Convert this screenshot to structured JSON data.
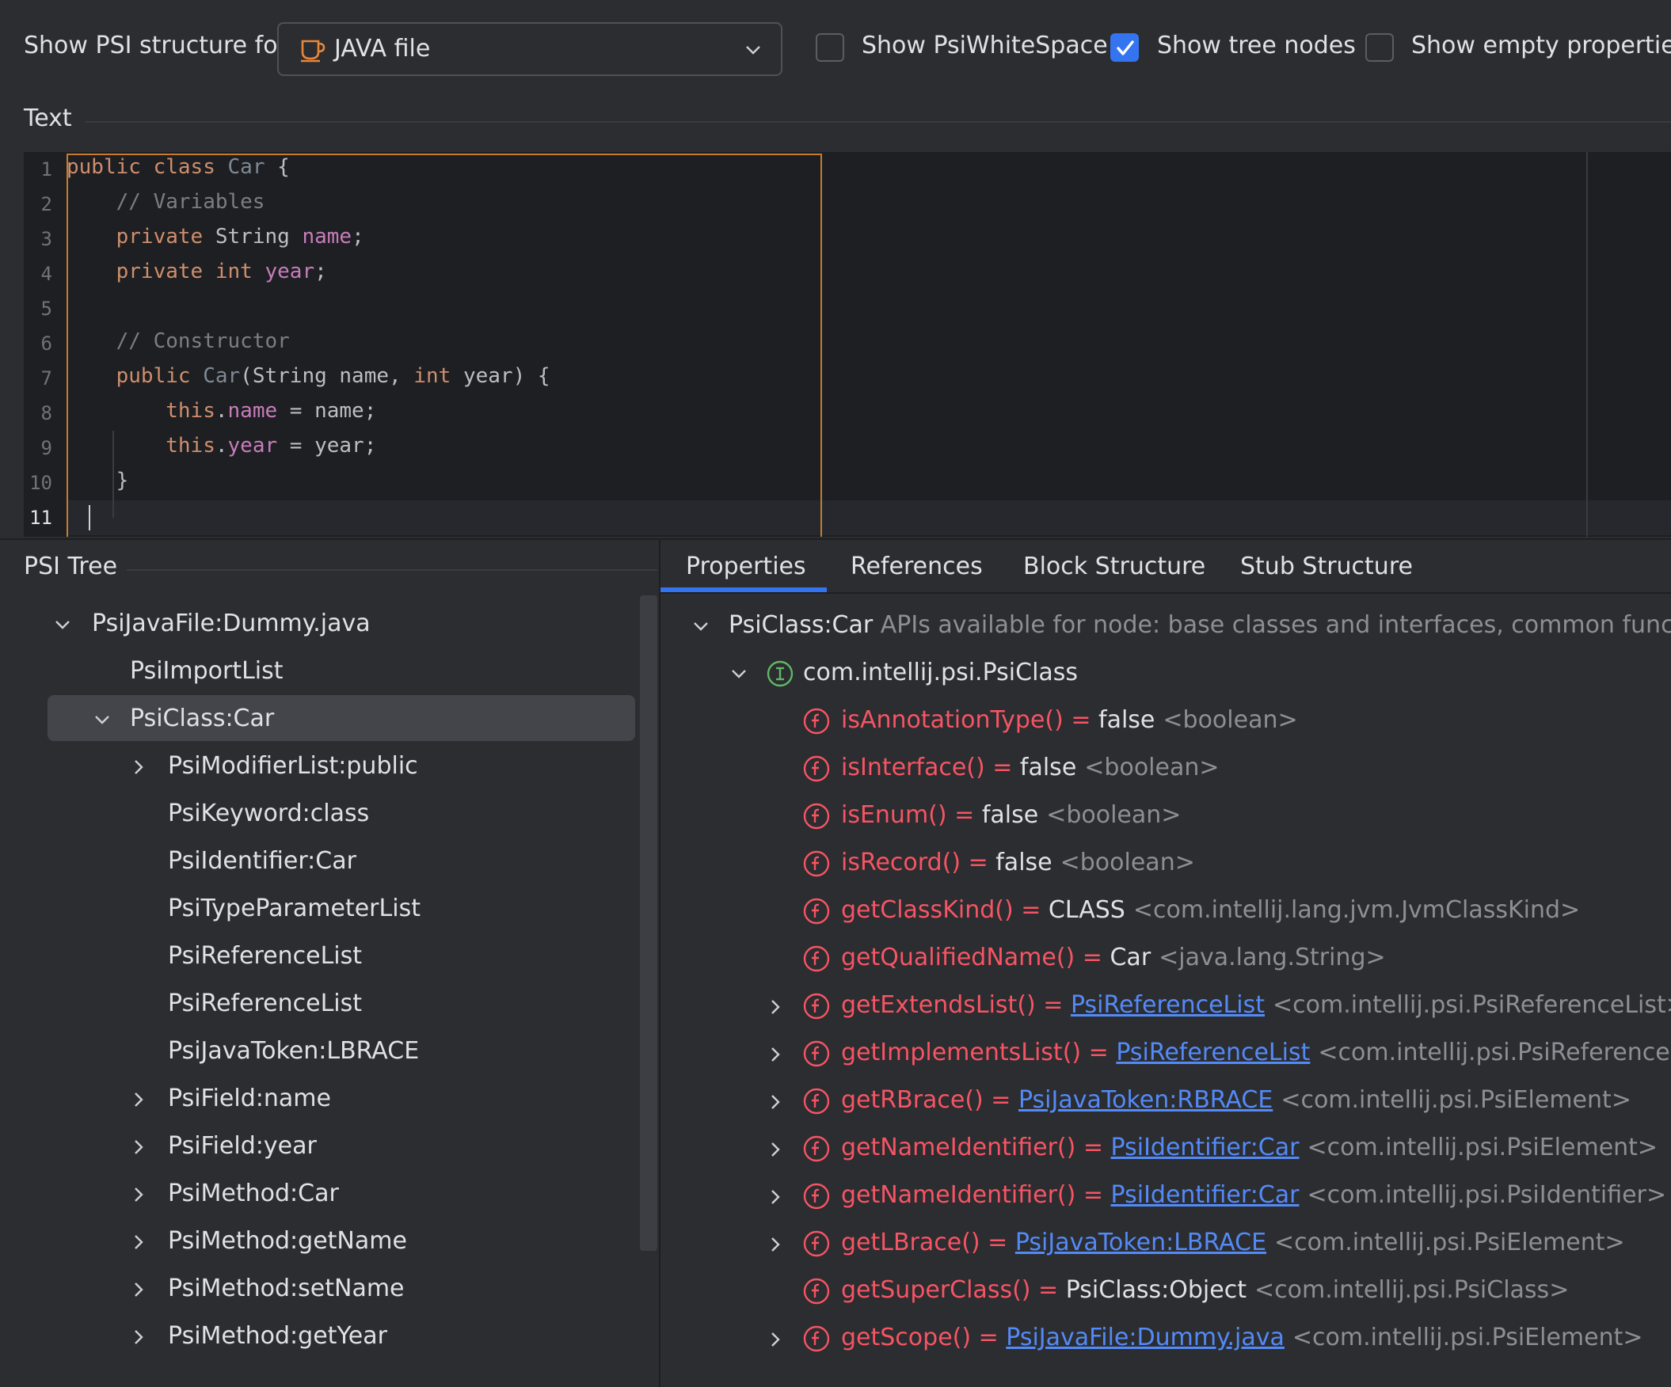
{
  "toolbar": {
    "show_for_label": "Show PSI structure for:",
    "file_type": "JAVA file",
    "file_type_icon": "java-cup-icon",
    "checkboxes": [
      {
        "label": "Show PsiWhiteSpace",
        "checked": false
      },
      {
        "label": "Show tree nodes",
        "checked": true
      },
      {
        "label": "Show empty properties",
        "checked": false
      }
    ]
  },
  "text_section": {
    "title": "Text",
    "line_numbers": [
      "1",
      "2",
      "3",
      "4",
      "5",
      "6",
      "7",
      "8",
      "9",
      "10",
      "11"
    ]
  },
  "psi_tree": {
    "title": "PSI Tree",
    "items": [
      "PsiJavaFile:Dummy.java",
      "PsiImportList",
      "PsiClass:Car",
      "PsiModifierList:public",
      "PsiKeyword:class",
      "PsiIdentifier:Car",
      "PsiTypeParameterList",
      "PsiReferenceList",
      "PsiReferenceList",
      "PsiJavaToken:LBRACE",
      "PsiField:name",
      "PsiField:year",
      "PsiMethod:Car",
      "PsiMethod:getName",
      "PsiMethod:setName",
      "PsiMethod:getYear"
    ],
    "selected": "PsiClass:Car"
  },
  "tabs": [
    "Properties",
    "References",
    "Block Structure",
    "Stub Structure"
  ],
  "active_tab": "Properties",
  "properties": {
    "root": {
      "name": "PsiClass:Car",
      "desc": "APIs available for node: base classes and interfaces, common functions"
    },
    "interface": "com.intellij.psi.PsiClass",
    "rows": [
      {
        "name": "isAnnotationType()",
        "eq": " = ",
        "value": "false",
        "type": "<boolean>"
      },
      {
        "name": "isInterface()",
        "eq": " = ",
        "value": "false",
        "type": "<boolean>"
      },
      {
        "name": "isEnum()",
        "eq": " = ",
        "value": "false",
        "type": "<boolean>"
      },
      {
        "name": "isRecord()",
        "eq": " = ",
        "value": "false",
        "type": "<boolean>"
      },
      {
        "name": "getClassKind()",
        "eq": " = ",
        "value": "CLASS",
        "type": "<com.intellij.lang.jvm.JvmClassKind>"
      },
      {
        "name": "getQualifiedName()",
        "eq": " = ",
        "value": "Car",
        "type": "<java.lang.String>"
      },
      {
        "name": "getExtendsList()",
        "eq": " = ",
        "link": "PsiReferenceList",
        "type": "<com.intellij.psi.PsiReferenceList>"
      },
      {
        "name": "getImplementsList()",
        "eq": " = ",
        "link": "PsiReferenceList",
        "type": "<com.intellij.psi.PsiReferenceList>"
      },
      {
        "name": "getRBrace()",
        "eq": " = ",
        "link": "PsiJavaToken:RBRACE",
        "type": "<com.intellij.psi.PsiElement>"
      },
      {
        "name": "getNameIdentifier()",
        "eq": " = ",
        "link": "PsiIdentifier:Car",
        "type": "<com.intellij.psi.PsiElement>"
      },
      {
        "name": "getNameIdentifier()",
        "eq": " = ",
        "link": "PsiIdentifier:Car",
        "type": "<com.intellij.psi.PsiIdentifier>"
      },
      {
        "name": "getLBrace()",
        "eq": " = ",
        "link": "PsiJavaToken:LBRACE",
        "type": "<com.intellij.psi.PsiElement>"
      },
      {
        "name": "getSuperClass()",
        "eq": " = ",
        "value": "PsiClass:Object",
        "type": "<com.intellij.psi.PsiClass>"
      },
      {
        "name": "getScope()",
        "eq": " = ",
        "link": "PsiJavaFile:Dummy.java",
        "type": "<com.intellij.psi.PsiElement>"
      }
    ]
  },
  "code": {
    "l1": {
      "k1": "public",
      "k2": "class",
      "cls": "Car",
      "rest": " {"
    },
    "l2": {
      "comment": "// Variables"
    },
    "l3": {
      "kw": "private",
      "type": " String ",
      "field": "name",
      "end": ";"
    },
    "l4": {
      "kw": "private",
      "type": "int",
      "field": "year",
      "end": ";"
    },
    "l6": {
      "comment": "// Constructor"
    },
    "l7": {
      "kw": "public",
      "name": "Car",
      "p1": "(String name, ",
      "kw2": "int",
      "p2": " year) {"
    },
    "l8": {
      "this": "this",
      "dot": ".",
      "field": "name",
      "rest": " = name;"
    },
    "l9": {
      "this": "this",
      "dot": ".",
      "field": "year",
      "rest": " = year;"
    },
    "l10": {
      "brace": "}"
    }
  },
  "colors": {
    "accent": "#3574f0",
    "error_red": "#f75464",
    "link": "#548af7",
    "selection_border": "#c77b2e"
  }
}
